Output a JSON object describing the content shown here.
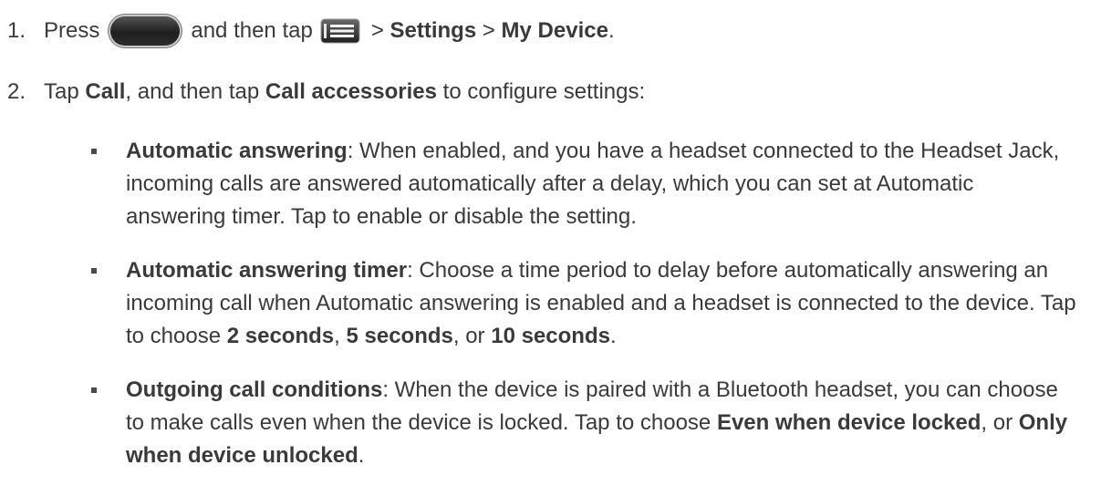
{
  "steps": [
    {
      "number": "1.",
      "t1": "Press",
      "t2": "and then tap",
      "t3": ">",
      "b1": "Settings",
      "t4": ">",
      "b2": "My Device",
      "t5": ".",
      "icons": [
        "home-key-icon",
        "menu-key-icon"
      ]
    },
    {
      "number": "2.",
      "t1": "Tap",
      "b1": "Call",
      "t2": ", and then tap",
      "b2": "Call accessories",
      "t3": "to configure settings:"
    }
  ],
  "bullets": [
    {
      "title": "Automatic answering",
      "body": ": When enabled, and you have a headset connected to the Headset Jack, incoming calls are answered automatically after a delay, which you can set at Automatic answering timer. Tap to enable or disable the setting."
    },
    {
      "title": "Automatic answering timer",
      "body": ": Choose a time period to delay before automatically answering an incoming call when Automatic answering is enabled and a headset is connected to the device. Tap to choose ",
      "opt1": "2 seconds",
      "sep1": ", ",
      "opt2": "5 seconds",
      "sep2": ", or ",
      "opt3": "10 seconds",
      "end": "."
    },
    {
      "title": "Outgoing call conditions",
      "body": ": When the device is paired with a Bluetooth headset, you can choose to make calls even when the device is locked. Tap to choose ",
      "opt1": "Even when device locked",
      "sep1": ", or ",
      "opt2": "Only when device unlocked",
      "end": "."
    }
  ]
}
